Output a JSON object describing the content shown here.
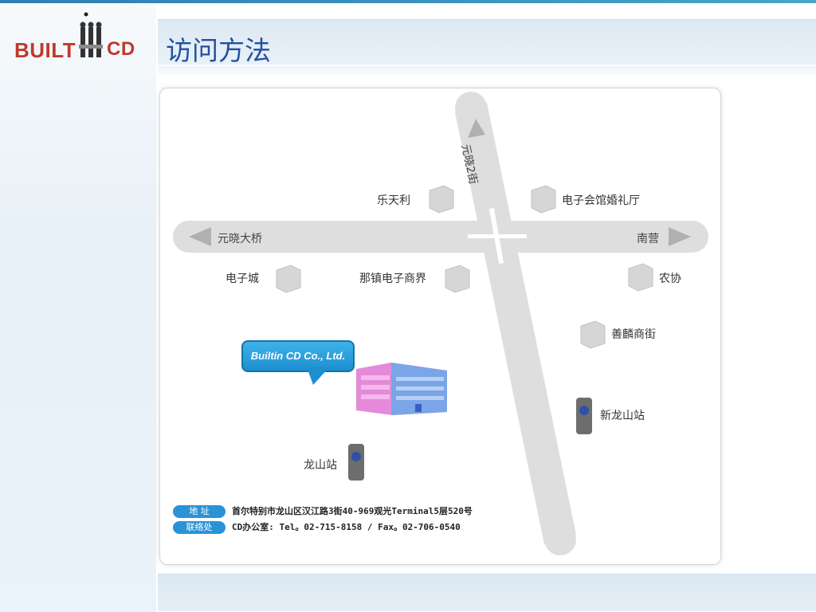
{
  "header": {
    "title": "访问方法",
    "logo_left": "BUILT",
    "logo_right": "CD"
  },
  "map": {
    "roads": {
      "horizontal_left": "元晓大桥",
      "horizontal_right": "南营",
      "vertical": "元晓2街"
    },
    "landmarks": [
      {
        "name": "乐天利"
      },
      {
        "name": "电子会馆婚礼厅"
      },
      {
        "name": "电子城"
      },
      {
        "name": "那镇电子商界"
      },
      {
        "name": "农协"
      },
      {
        "name": "善麟商街"
      }
    ],
    "stations": [
      {
        "name": "新龙山站"
      },
      {
        "name": "龙山站"
      }
    ],
    "company_callout": "Builtin CD  Co., Ltd."
  },
  "contact": {
    "address_label": "地  址",
    "address_value": "首尔特别市龙山区汉江路3街40-969观光Terminal5层520号",
    "contact_label": "联络处",
    "contact_value": "CD办公室: Tel。02-715-8158  /  Fax。02-706-0540"
  },
  "colors": {
    "title": "#2450a0",
    "logo": "#c0392b",
    "pill": "#2a93d6",
    "road": "#dcdcdc"
  }
}
